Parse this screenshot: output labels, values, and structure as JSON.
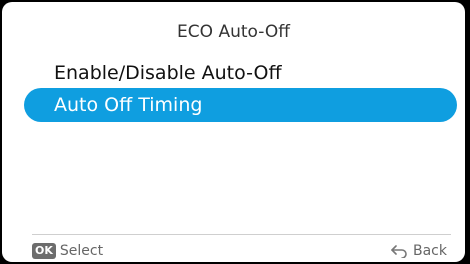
{
  "screen": {
    "title": "ECO Auto-Off"
  },
  "menu": {
    "items": [
      {
        "label": "Enable/Disable Auto-Off",
        "selected": false
      },
      {
        "label": "Auto Off Timing",
        "selected": true
      }
    ]
  },
  "footer": {
    "ok_badge": "OK",
    "select_label": "Select",
    "back_label": "Back",
    "icons": [
      "back-arrow-icon"
    ]
  },
  "colors": {
    "selection": "#0f9ee0",
    "background": "#ffffff"
  }
}
